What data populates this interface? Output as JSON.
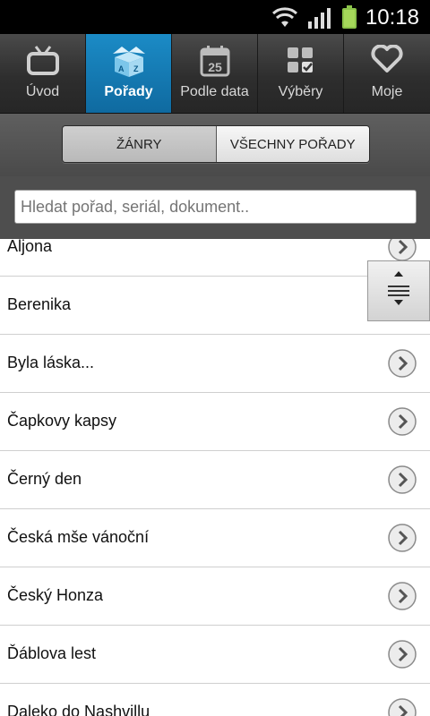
{
  "status": {
    "time": "10:18"
  },
  "tabs": [
    {
      "label": "Úvod",
      "icon": "tv-icon",
      "active": false
    },
    {
      "label": "Pořady",
      "icon": "az-box-icon",
      "active": true
    },
    {
      "label": "Podle data",
      "icon": "calendar-icon",
      "calendar_day": "25",
      "active": false
    },
    {
      "label": "Výběry",
      "icon": "grid-check-icon",
      "active": false
    },
    {
      "label": "Moje",
      "icon": "heart-icon",
      "active": false
    }
  ],
  "segments": {
    "genres": "ŽÁNRY",
    "all_shows": "VŠECHNY POŘADY",
    "selected": "genres"
  },
  "search": {
    "placeholder": "Hledat pořad, seriál, dokument.."
  },
  "shows": [
    "Aljona",
    "Berenika",
    "Byla láska...",
    "Čapkovy kapsy",
    "Černý den",
    "Česká mše vánoční",
    "Český Honza",
    "Ďáblova lest",
    "Daleko do Nashvillu"
  ],
  "colors": {
    "active_tab": "#1580BA",
    "tab_bar": "#2E2E2E"
  }
}
